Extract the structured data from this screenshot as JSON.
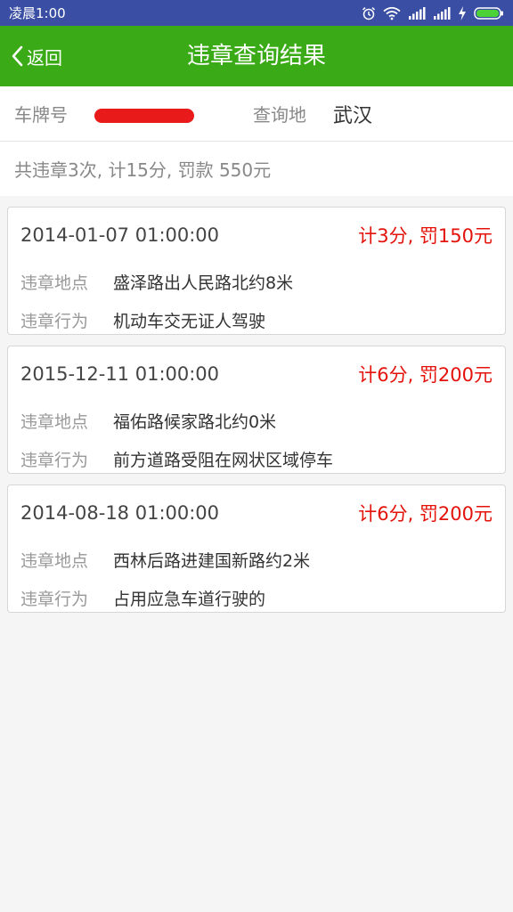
{
  "status_bar": {
    "time": "凌晨1:00"
  },
  "app_bar": {
    "back_label": "返回",
    "title": "违章查询结果"
  },
  "info": {
    "plate_label": "车牌号",
    "query_label": "查询地",
    "query_value": "武汉"
  },
  "summary": {
    "text": "共违章3次, 计15分, 罚款 550元"
  },
  "labels": {
    "location": "违章地点",
    "behavior": "违章行为"
  },
  "violations": [
    {
      "datetime": "2014-01-07 01:00:00",
      "penalty": "计3分, 罚150元",
      "location": "盛泽路出人民路北约8米",
      "behavior": "机动车交无证人驾驶"
    },
    {
      "datetime": "2015-12-11 01:00:00",
      "penalty": "计6分, 罚200元",
      "location": "福佑路候家路北约0米",
      "behavior": "前方道路受阻在网状区域停车"
    },
    {
      "datetime": "2014-08-18 01:00:00",
      "penalty": "计6分, 罚200元",
      "location": "西林后路进建国新路约2米",
      "behavior": "占用应急车道行驶的"
    }
  ],
  "colors": {
    "status_bar": "#3a4fa4",
    "app_bar": "#3aaa16",
    "penalty": "#e3120b",
    "redaction": "#e81a1a"
  },
  "icons": [
    "alarm-icon",
    "wifi-icon",
    "signal-icon",
    "signal-icon",
    "charging-icon",
    "battery-icon",
    "chevron-left-icon"
  ]
}
